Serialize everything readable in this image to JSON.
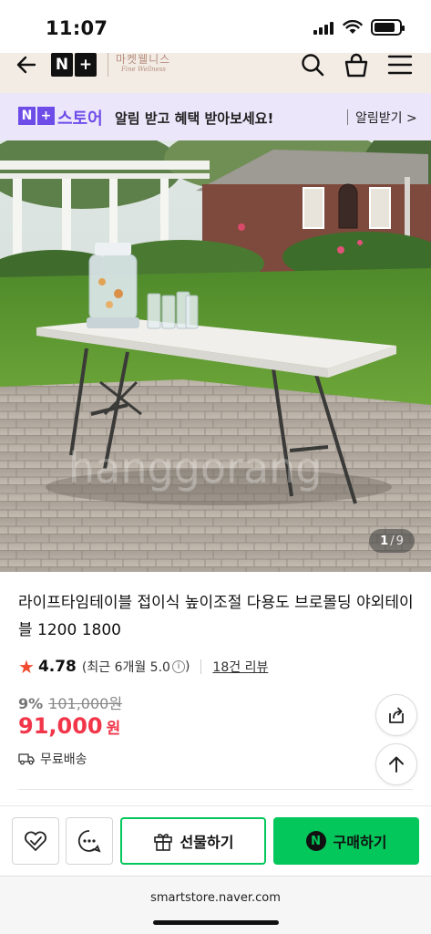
{
  "status_bar": {
    "time": "11:07"
  },
  "header": {
    "np_n": "N",
    "np_plus": "+",
    "shop_name": "마켓웰니스",
    "shop_sub": "Fine Wellness"
  },
  "banner": {
    "n": "N",
    "plus": "+",
    "store": "스토어",
    "message": "알림 받고 혜택 받아보세요!",
    "cta": "알림받기 >"
  },
  "gallery": {
    "current": "1",
    "separator": "/",
    "total": "9",
    "watermark": "hanggorang"
  },
  "product": {
    "title": "라이프타임테이블 접이식 높이조절 다용도 브로몰딩 야외테이블 1200 1800",
    "rating": "4.78",
    "rating_recent": "(최근 6개월 5.0",
    "rating_close": ")",
    "reviews": "18건 리뷰",
    "discount_pct": "9%",
    "original_price": "101,000원",
    "price": "91,000",
    "price_unit": "원",
    "shipping": "무료배송"
  },
  "actions": {
    "gift": "선물하기",
    "buy_n": "N",
    "buy": "구매하기"
  },
  "browser": {
    "url": "smartstore.naver.com"
  },
  "colors": {
    "naver_green": "#03c75a",
    "price_red": "#f2364a",
    "store_purple": "#6d4ce8",
    "star": "#f14a2e"
  },
  "icons": [
    "back-arrow-icon",
    "search-icon",
    "shopping-bag-icon",
    "menu-icon",
    "star-icon",
    "info-icon",
    "truck-icon",
    "share-icon",
    "arrow-up-icon",
    "heart-check-icon",
    "chat-icon",
    "gift-icon"
  ]
}
